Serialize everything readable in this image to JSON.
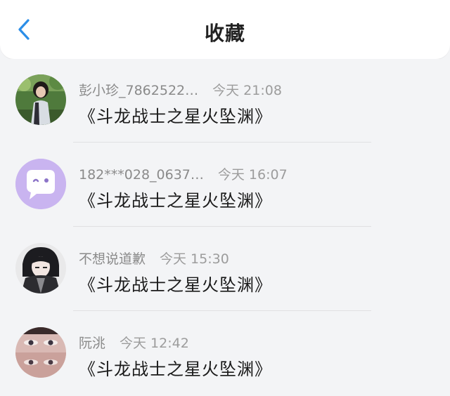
{
  "header": {
    "title": "收藏"
  },
  "items": [
    {
      "user": "彭小珍_7862522…",
      "time": "今天 21:08",
      "content": "《斗龙战士之星火坠渊》",
      "avatar_icon": "photo-avatar-girl"
    },
    {
      "user": "182***028_0637…",
      "time": "今天 16:07",
      "content": "《斗龙战士之星火坠渊》",
      "avatar_icon": "default-chat-bubble-avatar"
    },
    {
      "user": "不想说道歉",
      "time": "今天 15:30",
      "content": "《斗龙战士之星火坠渊》",
      "avatar_icon": "anime-avatar-dark"
    },
    {
      "user": "阮洮",
      "time": "今天 12:42",
      "content": "《斗龙战士之星火坠渊》",
      "avatar_icon": "photo-avatar-eyes"
    }
  ],
  "colors": {
    "accent": "#2b8ee8",
    "default_avatar_bg": "#c9b4f0"
  }
}
